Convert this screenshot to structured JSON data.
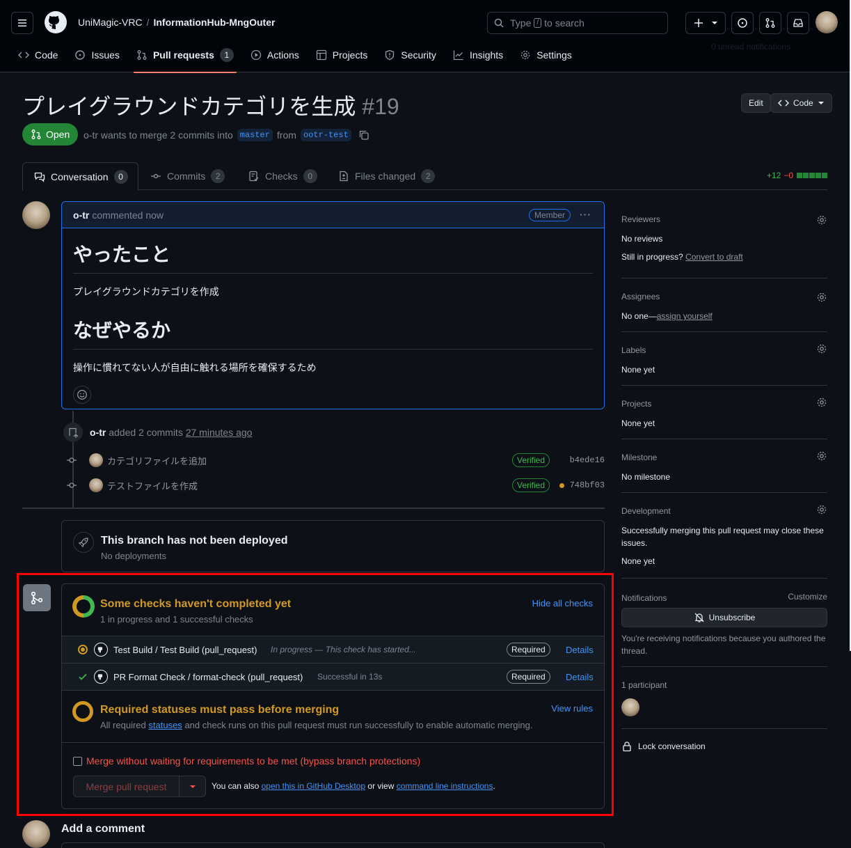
{
  "header": {
    "owner": "UniMagic-VRC",
    "separator": "/",
    "repo": "InformationHub-MngOuter",
    "search_prefix": "Type",
    "search_key": "/",
    "search_suffix": "to search",
    "ghost_text": "0 unread notifications"
  },
  "nav": {
    "code": "Code",
    "issues": "Issues",
    "pulls": "Pull requests",
    "pulls_count": "1",
    "actions": "Actions",
    "projects": "Projects",
    "security": "Security",
    "insights": "Insights",
    "settings": "Settings"
  },
  "pr": {
    "title": "プレイグラウンドカテゴリを生成",
    "number": "#19",
    "edit": "Edit",
    "code": "Code",
    "state": "Open",
    "author": "o-tr",
    "meta_1": "wants to merge 2 commits into",
    "base": "master",
    "meta_2": "from",
    "head": "ootr-test"
  },
  "tabs": {
    "conversation": "Conversation",
    "conversation_count": "0",
    "commits": "Commits",
    "commits_count": "2",
    "checks": "Checks",
    "checks_count": "0",
    "files": "Files changed",
    "files_count": "2",
    "additions": "+12",
    "deletions": "−0"
  },
  "comment": {
    "author": "o-tr",
    "time": "commented now",
    "badge": "Member",
    "h1": "やったこと",
    "p1": "プレイグラウンドカテゴリを作成",
    "h2": "なぜやるか",
    "p2": "操作に慣れてない人が自由に触れる場所を確保するため"
  },
  "commits_event": {
    "author": "o-tr",
    "text": "added 2 commits",
    "time": "27 minutes ago",
    "items": [
      {
        "message": "カテゴリファイルを追加",
        "verified": "Verified",
        "sha": "b4ede16"
      },
      {
        "message": "テストファイルを作成",
        "verified": "Verified",
        "sha": "748bf03"
      }
    ]
  },
  "deploy": {
    "title": "This branch has not been deployed",
    "sub": "No deployments"
  },
  "mergebox": {
    "checks_title": "Some checks haven't completed yet",
    "checks_sub": "1 in progress and 1 successful checks",
    "hide_checks": "Hide all checks",
    "check1_name": "Test Build / Test Build (pull_request)",
    "check1_status": "In progress — This check has started...",
    "check2_name": "PR Format Check / format-check (pull_request)",
    "check2_status": "Successful in 13s",
    "required": "Required",
    "details": "Details",
    "req_title": "Required statuses must pass before merging",
    "req_sub_1": "All required",
    "req_sub_link": "statuses",
    "req_sub_2": "and check runs on this pull request must run successfully to enable automatic merging.",
    "view_rules": "View rules",
    "bypass": "Merge without waiting for requirements to be met (bypass branch protections)",
    "merge_button": "Merge pull request",
    "note_1": "You can also",
    "note_link1": "open this in GitHub Desktop",
    "note_2": "or view",
    "note_link2": "command line instructions",
    "note_3": "."
  },
  "add_comment": "Add a comment",
  "sidebar": {
    "reviewers": "Reviewers",
    "reviewers_v": "No reviews",
    "progress": "Still in progress?",
    "convert": "Convert to draft",
    "assignees": "Assignees",
    "assignees_v": "No one—",
    "assign_self": "assign yourself",
    "labels": "Labels",
    "labels_v": "None yet",
    "projects": "Projects",
    "projects_v": "None yet",
    "milestone": "Milestone",
    "milestone_v": "No milestone",
    "development": "Development",
    "development_v": "Successfully merging this pull request may close these issues.",
    "development_v2": "None yet",
    "notifications": "Notifications",
    "customize": "Customize",
    "unsubscribe": "Unsubscribe",
    "notif_reason": "You're receiving notifications because you authored the thread.",
    "participants": "1 participant",
    "lock": "Lock conversation"
  }
}
